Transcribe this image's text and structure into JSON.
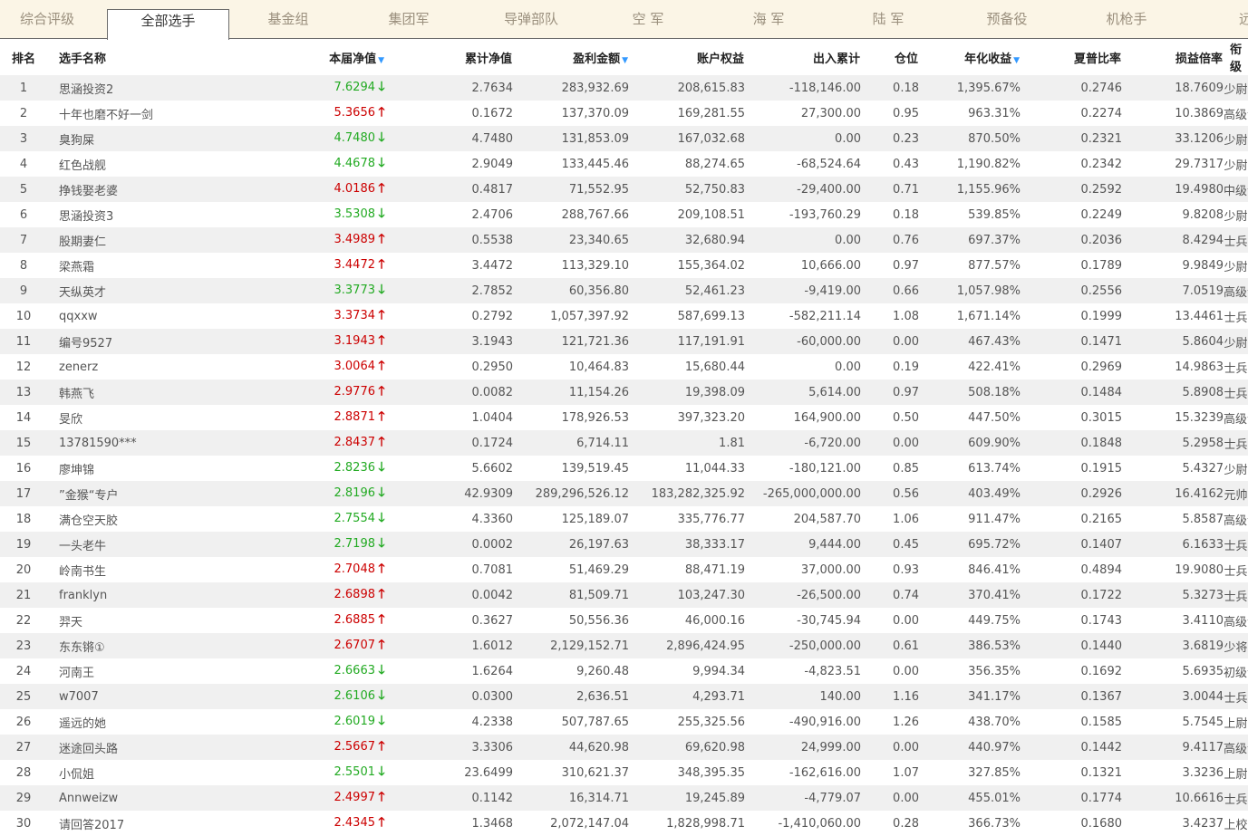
{
  "tabs": [
    "综合评级",
    "全部选手",
    "基金组",
    "集团军",
    "导弹部队",
    "空 军",
    "海 军",
    "陆 军",
    "预备役",
    "机枪手",
    "远程"
  ],
  "active_tab": 1,
  "columns": {
    "rank": "排名",
    "name": "选手名称",
    "nav": "本届净值",
    "cum": "累计净值",
    "profit": "盈利金额",
    "equity": "账户权益",
    "flow": "出入累计",
    "position": "仓位",
    "annual": "年化收益",
    "sharpe": "夏普比率",
    "pl_ratio": "损益倍率",
    "title": "衔级"
  },
  "sort_icon": "▼",
  "arrow_up": "🡑",
  "arrow_down": "🡓",
  "rows": [
    {
      "rank": "1",
      "name": "思涵投资2",
      "nav": "7.6294",
      "dir": "down",
      "cum": "2.7634",
      "profit": "283,932.69",
      "equity": "208,615.83",
      "flow": "-118,146.00",
      "position": "0.18",
      "annual": "1,395.67%",
      "sharpe": "0.2746",
      "pl_ratio": "18.7609",
      "title": "少尉"
    },
    {
      "rank": "2",
      "name": "十年也磨不好一剑",
      "nav": "5.3656",
      "dir": "up",
      "cum": "0.1672",
      "profit": "137,370.09",
      "equity": "169,281.55",
      "flow": "27,300.00",
      "position": "0.95",
      "annual": "963.31%",
      "sharpe": "0.2274",
      "pl_ratio": "10.3869",
      "title": "高级士官"
    },
    {
      "rank": "3",
      "name": "臭狗屎",
      "nav": "4.7480",
      "dir": "down",
      "cum": "4.7480",
      "profit": "131,853.09",
      "equity": "167,032.68",
      "flow": "0.00",
      "position": "0.23",
      "annual": "870.50%",
      "sharpe": "0.2321",
      "pl_ratio": "33.1206",
      "title": "少尉"
    },
    {
      "rank": "4",
      "name": "红色战舰",
      "nav": "4.4678",
      "dir": "down",
      "cum": "2.9049",
      "profit": "133,445.46",
      "equity": "88,274.65",
      "flow": "-68,524.64",
      "position": "0.43",
      "annual": "1,190.82%",
      "sharpe": "0.2342",
      "pl_ratio": "29.7317",
      "title": "少尉"
    },
    {
      "rank": "5",
      "name": "挣钱娶老婆",
      "nav": "4.0186",
      "dir": "up",
      "cum": "0.4817",
      "profit": "71,552.95",
      "equity": "52,750.83",
      "flow": "-29,400.00",
      "position": "0.71",
      "annual": "1,155.96%",
      "sharpe": "0.2592",
      "pl_ratio": "19.4980",
      "title": "中级士官"
    },
    {
      "rank": "6",
      "name": "思涵投资3",
      "nav": "3.5308",
      "dir": "down",
      "cum": "2.4706",
      "profit": "288,767.66",
      "equity": "209,108.51",
      "flow": "-193,760.29",
      "position": "0.18",
      "annual": "539.85%",
      "sharpe": "0.2249",
      "pl_ratio": "9.8208",
      "title": "少尉"
    },
    {
      "rank": "7",
      "name": "股期妻仁",
      "nav": "3.4989",
      "dir": "up",
      "cum": "0.5538",
      "profit": "23,340.65",
      "equity": "32,680.94",
      "flow": "0.00",
      "position": "0.76",
      "annual": "697.37%",
      "sharpe": "0.2036",
      "pl_ratio": "8.4294",
      "title": "士兵"
    },
    {
      "rank": "8",
      "name": "梁燕霜",
      "nav": "3.4472",
      "dir": "up",
      "cum": "3.4472",
      "profit": "113,329.10",
      "equity": "155,364.02",
      "flow": "10,666.00",
      "position": "0.97",
      "annual": "877.57%",
      "sharpe": "0.1789",
      "pl_ratio": "9.9849",
      "title": "少尉"
    },
    {
      "rank": "9",
      "name": "天纵英才",
      "nav": "3.3773",
      "dir": "down",
      "cum": "2.7852",
      "profit": "60,356.80",
      "equity": "52,461.23",
      "flow": "-9,419.00",
      "position": "0.66",
      "annual": "1,057.98%",
      "sharpe": "0.2556",
      "pl_ratio": "7.0519",
      "title": "高级士官"
    },
    {
      "rank": "10",
      "name": "qqxxw",
      "nav": "3.3734",
      "dir": "up",
      "cum": "0.2792",
      "profit": "1,057,397.92",
      "equity": "587,699.13",
      "flow": "-582,211.14",
      "position": "1.08",
      "annual": "1,671.14%",
      "sharpe": "0.1999",
      "pl_ratio": "13.4461",
      "title": "士兵"
    },
    {
      "rank": "11",
      "name": "编号9527",
      "nav": "3.1943",
      "dir": "up",
      "cum": "3.1943",
      "profit": "121,721.36",
      "equity": "117,191.91",
      "flow": "-60,000.00",
      "position": "0.00",
      "annual": "467.43%",
      "sharpe": "0.1471",
      "pl_ratio": "5.8604",
      "title": "少尉"
    },
    {
      "rank": "12",
      "name": "zenerz",
      "nav": "3.0064",
      "dir": "up",
      "cum": "0.2950",
      "profit": "10,464.83",
      "equity": "15,680.44",
      "flow": "0.00",
      "position": "0.19",
      "annual": "422.41%",
      "sharpe": "0.2969",
      "pl_ratio": "14.9863",
      "title": "士兵"
    },
    {
      "rank": "13",
      "name": "韩燕飞",
      "nav": "2.9776",
      "dir": "up",
      "cum": "0.0082",
      "profit": "11,154.26",
      "equity": "19,398.09",
      "flow": "5,614.00",
      "position": "0.97",
      "annual": "508.18%",
      "sharpe": "0.1484",
      "pl_ratio": "5.8908",
      "title": "士兵"
    },
    {
      "rank": "14",
      "name": "旻欣",
      "nav": "2.8871",
      "dir": "up",
      "cum": "1.0404",
      "profit": "178,926.53",
      "equity": "397,323.20",
      "flow": "164,900.00",
      "position": "0.50",
      "annual": "447.50%",
      "sharpe": "0.3015",
      "pl_ratio": "15.3239",
      "title": "高级士官"
    },
    {
      "rank": "15",
      "name": "13781590***",
      "nav": "2.8437",
      "dir": "up",
      "cum": "0.1724",
      "profit": "6,714.11",
      "equity": "1.81",
      "flow": "-6,720.00",
      "position": "0.00",
      "annual": "609.90%",
      "sharpe": "0.1848",
      "pl_ratio": "5.2958",
      "title": "士兵"
    },
    {
      "rank": "16",
      "name": "廖坤锦",
      "nav": "2.8236",
      "dir": "down",
      "cum": "5.6602",
      "profit": "139,519.45",
      "equity": "11,044.33",
      "flow": "-180,121.00",
      "position": "0.85",
      "annual": "613.74%",
      "sharpe": "0.1915",
      "pl_ratio": "5.4327",
      "title": "少尉"
    },
    {
      "rank": "17",
      "name": "”金猴“专户",
      "nav": "2.8196",
      "dir": "down",
      "cum": "42.9309",
      "profit": "289,296,526.12",
      "equity": "183,282,325.92",
      "flow": "-265,000,000.00",
      "position": "0.56",
      "annual": "403.49%",
      "sharpe": "0.2926",
      "pl_ratio": "16.4162",
      "title": "元帅"
    },
    {
      "rank": "18",
      "name": "满仓空天胶",
      "nav": "2.7554",
      "dir": "down",
      "cum": "4.3360",
      "profit": "125,189.07",
      "equity": "335,776.77",
      "flow": "204,587.70",
      "position": "1.06",
      "annual": "911.47%",
      "sharpe": "0.2165",
      "pl_ratio": "5.8587",
      "title": "高级士官"
    },
    {
      "rank": "19",
      "name": "一头老牛",
      "nav": "2.7198",
      "dir": "down",
      "cum": "0.0002",
      "profit": "26,197.63",
      "equity": "38,333.17",
      "flow": "9,444.00",
      "position": "0.45",
      "annual": "695.72%",
      "sharpe": "0.1407",
      "pl_ratio": "6.1633",
      "title": "士兵"
    },
    {
      "rank": "20",
      "name": "岭南书生",
      "nav": "2.7048",
      "dir": "up",
      "cum": "0.7081",
      "profit": "51,469.29",
      "equity": "88,471.19",
      "flow": "37,000.00",
      "position": "0.93",
      "annual": "846.41%",
      "sharpe": "0.4894",
      "pl_ratio": "19.9080",
      "title": "士兵"
    },
    {
      "rank": "21",
      "name": "franklyn",
      "nav": "2.6898",
      "dir": "up",
      "cum": "0.0042",
      "profit": "81,509.71",
      "equity": "103,247.30",
      "flow": "-26,500.00",
      "position": "0.74",
      "annual": "370.41%",
      "sharpe": "0.1722",
      "pl_ratio": "5.3273",
      "title": "士兵"
    },
    {
      "rank": "22",
      "name": "羿天",
      "nav": "2.6885",
      "dir": "up",
      "cum": "0.3627",
      "profit": "50,556.36",
      "equity": "46,000.16",
      "flow": "-30,745.94",
      "position": "0.00",
      "annual": "449.75%",
      "sharpe": "0.1743",
      "pl_ratio": "3.4110",
      "title": "高级士官"
    },
    {
      "rank": "23",
      "name": "东东锵①",
      "nav": "2.6707",
      "dir": "up",
      "cum": "1.6012",
      "profit": "2,129,152.71",
      "equity": "2,896,424.95",
      "flow": "-250,000.00",
      "position": "0.61",
      "annual": "386.53%",
      "sharpe": "0.1440",
      "pl_ratio": "3.6819",
      "title": "少将"
    },
    {
      "rank": "24",
      "name": "河南王",
      "nav": "2.6663",
      "dir": "down",
      "cum": "1.6264",
      "profit": "9,260.48",
      "equity": "9,994.34",
      "flow": "-4,823.51",
      "position": "0.00",
      "annual": "356.35%",
      "sharpe": "0.1692",
      "pl_ratio": "5.6935",
      "title": "初级士官"
    },
    {
      "rank": "25",
      "name": "w7007",
      "nav": "2.6106",
      "dir": "down",
      "cum": "0.0300",
      "profit": "2,636.51",
      "equity": "4,293.71",
      "flow": "140.00",
      "position": "1.16",
      "annual": "341.17%",
      "sharpe": "0.1367",
      "pl_ratio": "3.0044",
      "title": "士兵"
    },
    {
      "rank": "26",
      "name": "遥远的她",
      "nav": "2.6019",
      "dir": "down",
      "cum": "4.2338",
      "profit": "507,787.65",
      "equity": "255,325.56",
      "flow": "-490,916.00",
      "position": "1.26",
      "annual": "438.70%",
      "sharpe": "0.1585",
      "pl_ratio": "5.7545",
      "title": "上尉"
    },
    {
      "rank": "27",
      "name": "迷途回头路",
      "nav": "2.5667",
      "dir": "up",
      "cum": "3.3306",
      "profit": "44,620.98",
      "equity": "69,620.98",
      "flow": "24,999.00",
      "position": "0.00",
      "annual": "440.97%",
      "sharpe": "0.1442",
      "pl_ratio": "9.4117",
      "title": "高级士官"
    },
    {
      "rank": "28",
      "name": "小侃姐",
      "nav": "2.5501",
      "dir": "down",
      "cum": "23.6499",
      "profit": "310,621.37",
      "equity": "348,395.35",
      "flow": "-162,616.00",
      "position": "1.07",
      "annual": "327.85%",
      "sharpe": "0.1321",
      "pl_ratio": "3.3236",
      "title": "上尉"
    },
    {
      "rank": "29",
      "name": "Annweizw",
      "nav": "2.4997",
      "dir": "up",
      "cum": "0.1142",
      "profit": "16,314.71",
      "equity": "19,245.89",
      "flow": "-4,779.07",
      "position": "0.00",
      "annual": "455.01%",
      "sharpe": "0.1774",
      "pl_ratio": "10.6616",
      "title": "士兵"
    },
    {
      "rank": "30",
      "name": "请回答2017",
      "nav": "2.4345",
      "dir": "up",
      "cum": "1.3468",
      "profit": "2,072,147.04",
      "equity": "1,828,998.71",
      "flow": "-1,410,060.00",
      "position": "0.28",
      "annual": "366.73%",
      "sharpe": "0.1680",
      "pl_ratio": "3.4237",
      "title": "上校"
    }
  ]
}
